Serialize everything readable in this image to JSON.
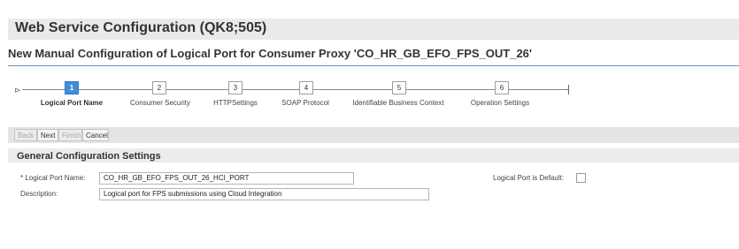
{
  "window": {
    "title": "Web Service Configuration (QK8;505)",
    "subtitle": "New Manual Configuration of Logical Port for Consumer Proxy 'CO_HR_GB_EFO_FPS_OUT_26'"
  },
  "roadmap": {
    "start_marker": "⊳",
    "steps": [
      {
        "number": "1",
        "label": "Logical Port Name",
        "active": true
      },
      {
        "number": "2",
        "label": "Consumer Security",
        "active": false
      },
      {
        "number": "3",
        "label": "HTTPSettings",
        "active": false
      },
      {
        "number": "4",
        "label": "SOAP Protocol",
        "active": false
      },
      {
        "number": "5",
        "label": "Identifiable Business Context",
        "active": false
      },
      {
        "number": "6",
        "label": "Operation Settings",
        "active": false
      }
    ]
  },
  "toolbar": {
    "back": "Back",
    "next": "Next",
    "finish": "Finish",
    "cancel": "Cancel"
  },
  "section": {
    "title": "General Configuration Settings"
  },
  "form": {
    "logical_port_name_label": "* Logical Port Name:",
    "logical_port_name_value": "CO_HR_GB_EFO_FPS_OUT_26_HCI_PORT",
    "description_label": "Description:",
    "description_value": "Logical port for FPS submissions using Cloud Integration",
    "is_default_label": "Logical Port is Default:",
    "is_default_checked": false
  },
  "colors": {
    "active_step": "#3f8fd6",
    "rule": "#6c8fb5",
    "header_bg": "#eaeaea"
  }
}
